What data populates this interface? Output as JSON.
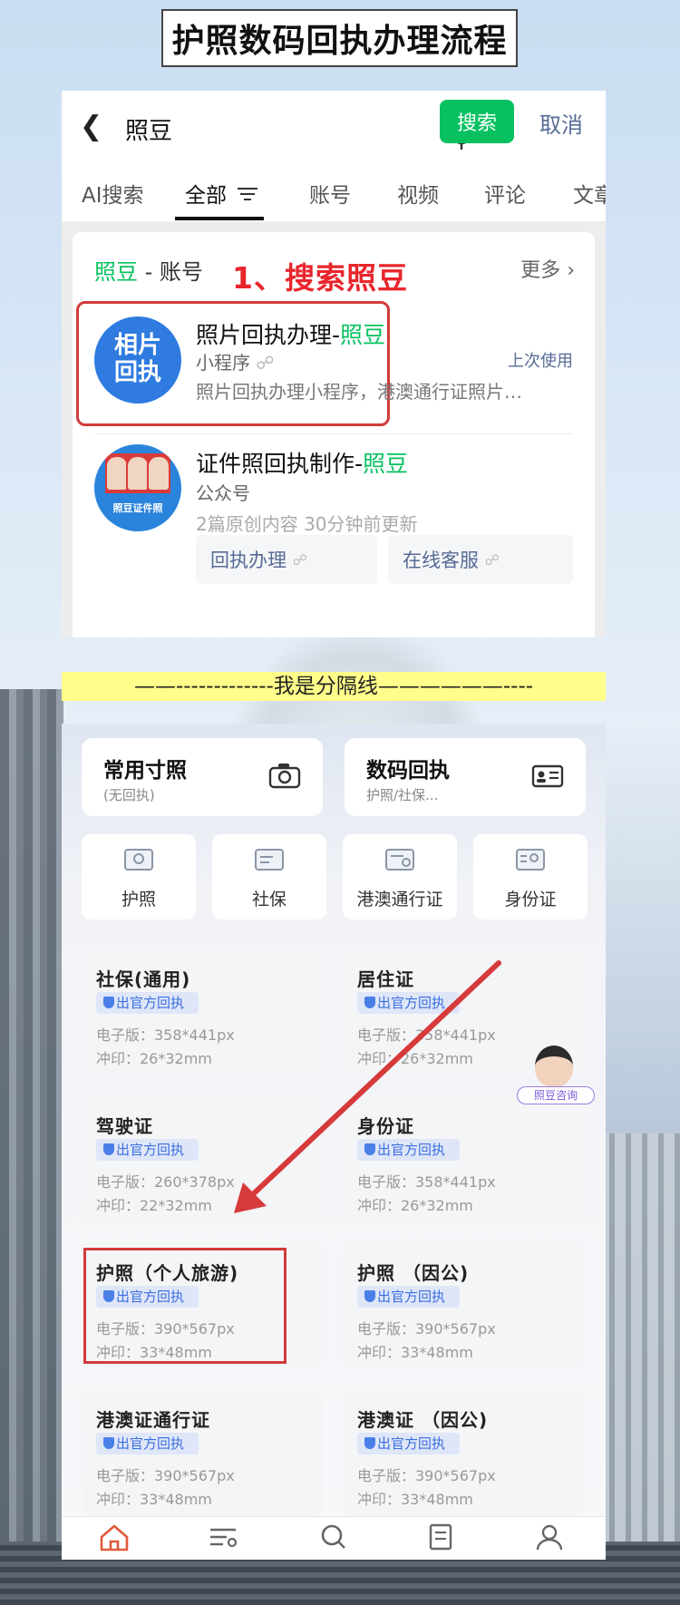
{
  "title": "护照数码回执办理流程",
  "search": {
    "query": "照豆",
    "search_button": "搜索",
    "cancel": "取消"
  },
  "tabs": [
    {
      "label": "AI搜索"
    },
    {
      "label": "全部",
      "active": true
    },
    {
      "label": "账号"
    },
    {
      "label": "视频"
    },
    {
      "label": "评论"
    },
    {
      "label": "文章"
    }
  ],
  "results": {
    "section_brand": "照豆",
    "section_suffix": " - 账号",
    "more": "更多",
    "annotation": "1、搜索照豆",
    "items": [
      {
        "avatar_text_1": "相片",
        "avatar_text_2": "回执",
        "title_prefix": "照片回执办理-",
        "title_brand": "照豆",
        "type": "小程序",
        "desc": "照片回执办理小程序，港澳通行证照片回…",
        "last_used": "上次使用"
      },
      {
        "avatar_label": "照豆证件照",
        "title_prefix": "证件照回执制作-",
        "title_brand": "照豆",
        "type": "公众号",
        "desc": "2篇原创内容  30分钟前更新",
        "buttons": [
          "回执办理",
          "在线客服"
        ]
      }
    ]
  },
  "separator": "——-------------我是分隔线——————----",
  "app": {
    "top_cards": [
      {
        "title": "常用寸照",
        "sub": "(无回执)",
        "icon": "camera-icon"
      },
      {
        "title": "数码回执",
        "sub": "护照/社保...",
        "icon": "id-card-icon"
      }
    ],
    "doc_types": [
      {
        "label": "护照",
        "icon": "passport-icon"
      },
      {
        "label": "社保",
        "icon": "social-security-icon"
      },
      {
        "label": "港澳通行证",
        "icon": "permit-icon"
      },
      {
        "label": "身份证",
        "icon": "id-icon"
      }
    ],
    "badge": "出官方回执",
    "specs": [
      {
        "name": "社保(通用)",
        "e": "电子版：358*441px",
        "p": "冲印：26*32mm"
      },
      {
        "name": "居住证",
        "e": "电子版：358*441px",
        "p": "冲印：26*32mm"
      },
      {
        "name": "驾驶证",
        "e": "电子版：260*378px",
        "p": "冲印：22*32mm"
      },
      {
        "name": "身份证",
        "e": "电子版：358*441px",
        "p": "冲印：26*32mm"
      },
      {
        "name": "护照（个人旅游)",
        "e": "电子版：390*567px",
        "p": "冲印：33*48mm"
      },
      {
        "name": "护照 （因公)",
        "e": "电子版：390*567px",
        "p": "冲印：33*48mm"
      },
      {
        "name": "港澳证通行证",
        "e": "电子版：390*567px",
        "p": "冲印：33*48mm"
      },
      {
        "name": "港澳证 （因公)",
        "e": "电子版：390*567px",
        "p": "冲印：33*48mm"
      }
    ],
    "consult": "照豆咨询",
    "nav": [
      {
        "icon": "home-icon"
      },
      {
        "icon": "list-icon"
      },
      {
        "icon": "search-icon"
      },
      {
        "icon": "document-icon"
      },
      {
        "icon": "user-icon"
      }
    ]
  },
  "colors": {
    "brand_green": "#07c160",
    "annotation_red": "#e8262c",
    "link_blue": "#576b95",
    "separator_yellow": "#fffe8a"
  }
}
